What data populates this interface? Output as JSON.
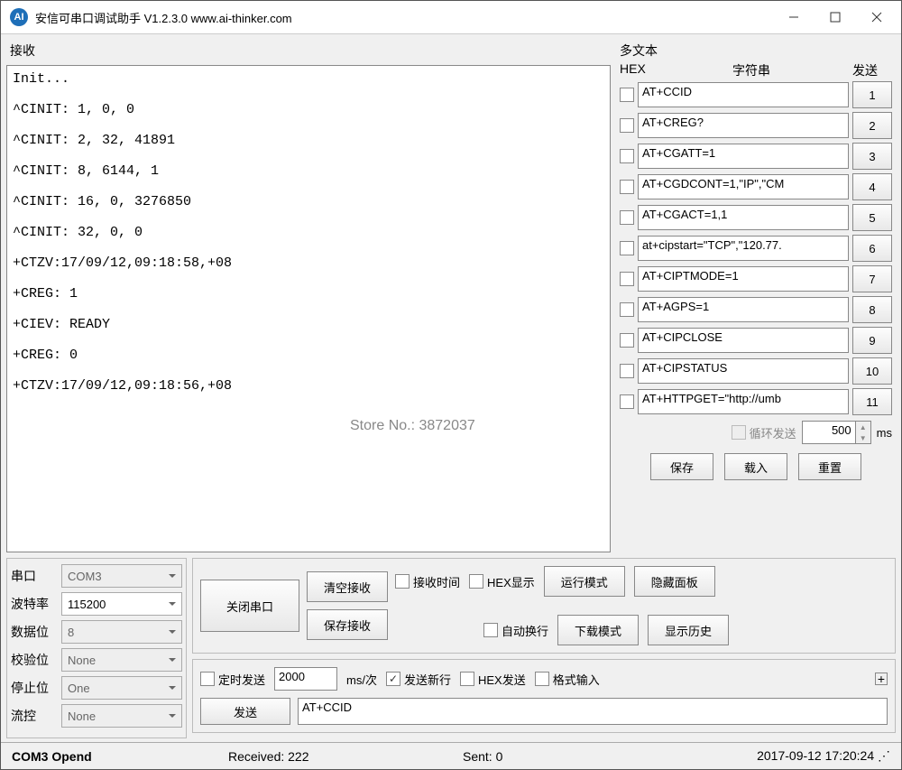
{
  "window": {
    "title": "安信可串口调试助手 V1.2.3.0        www.ai-thinker.com"
  },
  "receive": {
    "label": "接收",
    "content": "Init...\n\n^CINIT: 1, 0, 0\n\n^CINIT: 2, 32, 41891\n\n^CINIT: 8, 6144, 1\n\n^CINIT: 16, 0, 3276850\n\n^CINIT: 32, 0, 0\n\n+CTZV:17/09/12,09:18:58,+08\n\n+CREG: 1\n\n+CIEV: READY\n\n+CREG: 0\n\n+CTZV:17/09/12,09:18:56,+08\n"
  },
  "watermark": "Store No.: 3872037",
  "multi": {
    "title": "多文本",
    "hex_header": "HEX",
    "str_header": "字符串",
    "send_header": "发送",
    "rows": [
      {
        "text": "AT+CCID",
        "num": "1"
      },
      {
        "text": "AT+CREG?",
        "num": "2"
      },
      {
        "text": "AT+CGATT=1",
        "num": "3"
      },
      {
        "text": "AT+CGDCONT=1,\"IP\",\"CM",
        "num": "4"
      },
      {
        "text": "AT+CGACT=1,1",
        "num": "5"
      },
      {
        "text": "at+cipstart=\"TCP\",\"120.77.",
        "num": "6"
      },
      {
        "text": "AT+CIPTMODE=1",
        "num": "7"
      },
      {
        "text": "AT+AGPS=1",
        "num": "8"
      },
      {
        "text": "AT+CIPCLOSE",
        "num": "9"
      },
      {
        "text": "AT+CIPSTATUS",
        "num": "10"
      },
      {
        "text": "AT+HTTPGET=\"http://umb",
        "num": "11"
      }
    ],
    "loop_label": "循环发送",
    "loop_value": "500",
    "loop_unit": "ms",
    "save": "保存",
    "load": "载入",
    "reset": "重置"
  },
  "serial": {
    "port_label": "串口",
    "port_value": "COM3",
    "baud_label": "波特率",
    "baud_value": "115200",
    "data_label": "数据位",
    "data_value": "8",
    "parity_label": "校验位",
    "parity_value": "None",
    "stop_label": "停止位",
    "stop_value": "One",
    "flow_label": "流控",
    "flow_value": "None"
  },
  "controls": {
    "close_port": "关闭串口",
    "clear_recv": "清空接收",
    "save_recv": "保存接收",
    "recv_time": "接收时间",
    "hex_show": "HEX显示",
    "auto_wrap": "自动换行",
    "run_mode": "运行模式",
    "dl_mode": "下载模式",
    "hide_panel": "隐藏面板",
    "show_history": "显示历史",
    "timed_send": "定时发送",
    "timed_value": "2000",
    "timed_unit": "ms/次",
    "send_newline": "发送新行",
    "hex_send": "HEX发送",
    "format_input": "格式输入",
    "send_btn": "发送",
    "send_value": "AT+CCID"
  },
  "status": {
    "port": "COM3 Opend",
    "received": "Received: 222",
    "sent": "Sent: 0",
    "time": "2017-09-12 17:20:24"
  }
}
